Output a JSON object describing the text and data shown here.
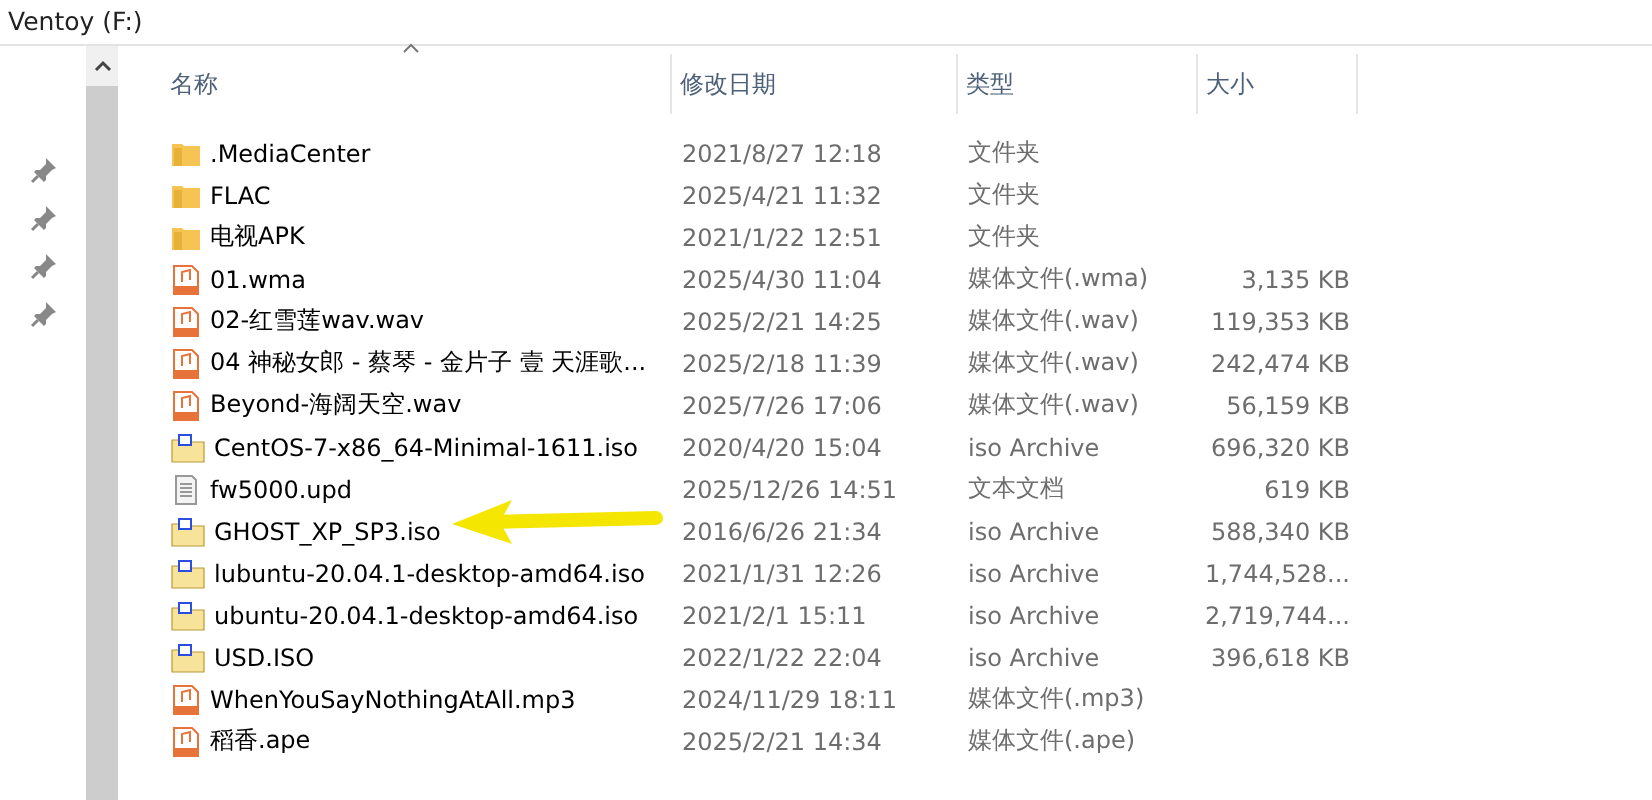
{
  "window": {
    "title": "Ventoy (F:)"
  },
  "table": {
    "columns": [
      "名称",
      "修改日期",
      "类型",
      "大小"
    ],
    "rows": [
      {
        "kind": "folder",
        "name": ".MediaCenter",
        "modified": "2021/8/27 12:18",
        "type": "文件夹"
      },
      {
        "kind": "folder",
        "name": "FLAC",
        "modified": "2025/4/21 11:32",
        "type": "文件夹"
      },
      {
        "kind": "folder",
        "name": "电视APK",
        "modified": "2021/1/22 12:51",
        "type": "文件夹"
      },
      {
        "kind": "audio",
        "name": "01.wma",
        "modified": "2025/4/30 11:04",
        "type": "媒体文件(.wma)",
        "size": "3,135 KB"
      },
      {
        "kind": "audio",
        "name": "02-红雪莲wav.wav",
        "modified": "2025/2/21 14:25",
        "type": "媒体文件(.wav)",
        "size": "119,353 KB"
      },
      {
        "kind": "audio",
        "name": "04 神秘女郎 - 蔡琴 - 金片子 壹 天涯歌...",
        "modified": "2025/2/18 11:39",
        "type": "媒体文件(.wav)",
        "size": "242,474 KB"
      },
      {
        "kind": "audio",
        "name": "Beyond-海阔天空.wav",
        "modified": "2025/7/26 17:06",
        "type": "媒体文件(.wav)",
        "size": "56,159 KB"
      },
      {
        "kind": "iso",
        "name": "CentOS-7-x86_64-Minimal-1611.iso",
        "modified": "2020/4/20 15:04",
        "type": "iso Archive",
        "size": "696,320 KB"
      },
      {
        "kind": "text",
        "name": "fw5000.upd",
        "modified": "2025/12/26 14:51",
        "type": "文本文档",
        "size": "619 KB"
      },
      {
        "kind": "iso",
        "name": "GHOST_XP_SP3.iso",
        "modified": "2016/6/26 21:34",
        "type": "iso Archive",
        "size": "588,340 KB"
      },
      {
        "kind": "iso",
        "name": "lubuntu-20.04.1-desktop-amd64.iso",
        "modified": "2021/1/31 12:26",
        "type": "iso Archive",
        "size": "1,744,528..."
      },
      {
        "kind": "iso",
        "name": "ubuntu-20.04.1-desktop-amd64.iso",
        "modified": "2021/2/1 15:11",
        "type": "iso Archive",
        "size": "2,719,744..."
      },
      {
        "kind": "iso",
        "name": "USD.ISO",
        "modified": "2022/1/22 22:04",
        "type": "iso Archive",
        "size": "396,618 KB"
      },
      {
        "kind": "audio",
        "name": "WhenYouSayNothingAtAll.mp3",
        "modified": "2024/11/29 18:11",
        "type": "媒体文件(.mp3)"
      },
      {
        "kind": "audio",
        "name": "稻香.ape",
        "modified": "2025/2/21 14:34",
        "type": "媒体文件(.ape)"
      }
    ]
  }
}
